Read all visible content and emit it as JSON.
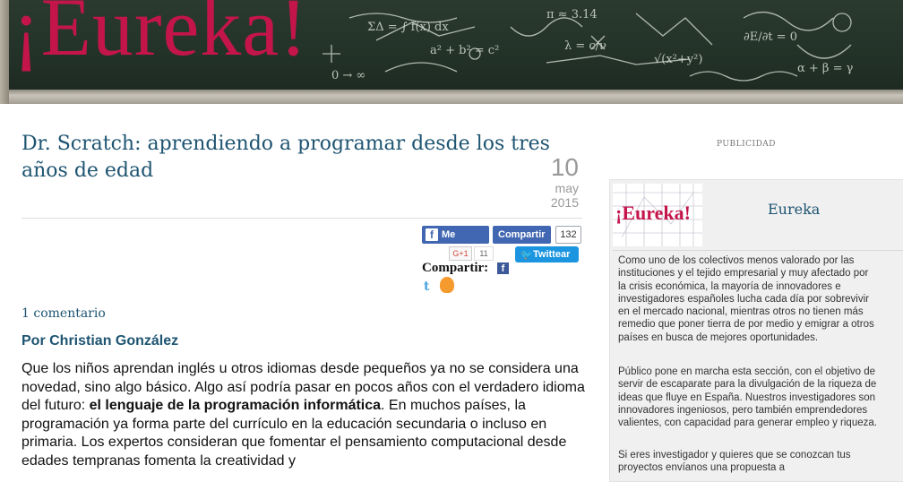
{
  "header": {
    "logo_text": "¡Eureka!"
  },
  "article": {
    "title": "Dr. Scratch: aprendiendo a programar desde los tres años de edad",
    "date": {
      "day": "10",
      "month": "may",
      "year": "2015"
    },
    "social": {
      "fb_like_label": "Me gusta",
      "fb_share_label": "Compartir",
      "share_count": "132",
      "gplus_label": "G+1",
      "gplus_count": "11",
      "tweet_label": "Twittear",
      "compartir_label": "Compartir:"
    },
    "comments_link": "1 comentario",
    "byline": "Por Christian González",
    "body": {
      "p1_part1": "Que los niños aprendan inglés u otros idiomas desde pequeños ya no se considera una novedad, sino algo básico. Algo así podría pasar en pocos años con el verdadero idioma del futuro: ",
      "p1_bold": "el lenguaje de la programación informática",
      "p1_part2": ". En muchos países, la programación ya forma parte del currículo en la educación secundaria o incluso en primaria. Los expertos consideran que fomentar el pensamiento computacional desde edades tempranas fomenta la creatividad y"
    }
  },
  "sidebar": {
    "publicidad": "PUBLICIDAD",
    "widget_logo_text": "¡Eureka!",
    "widget_title": "Eureka",
    "paragraphs": [
      "Como uno de los colectivos menos valorado por las instituciones y el tejido empresarial y muy afectado por la crisis económica, la mayoría de innovadores e investigadores españoles lucha cada día por sobrevivir en el mercado nacional, mientras otros no tienen más remedio que poner tierra de por medio y emigrar a otros países en busca de mejores oportunidades.",
      "Público pone en marcha esta sección, con el objetivo de servir de escaparate para la divulgación de la riqueza de ideas que fluye en España. Nuestros investigadores son innovadores ingeniosos, pero también emprendedores valientes, con capacidad para generar empleo y riqueza.",
      "Si eres investigador y quieres que se conozcan tus proyectos envíanos una propuesta a"
    ]
  },
  "colors": {
    "brand_red": "#c4154b",
    "link_blue": "#1e5471",
    "facebook": "#4267b2",
    "twitter": "#1b95e0"
  }
}
